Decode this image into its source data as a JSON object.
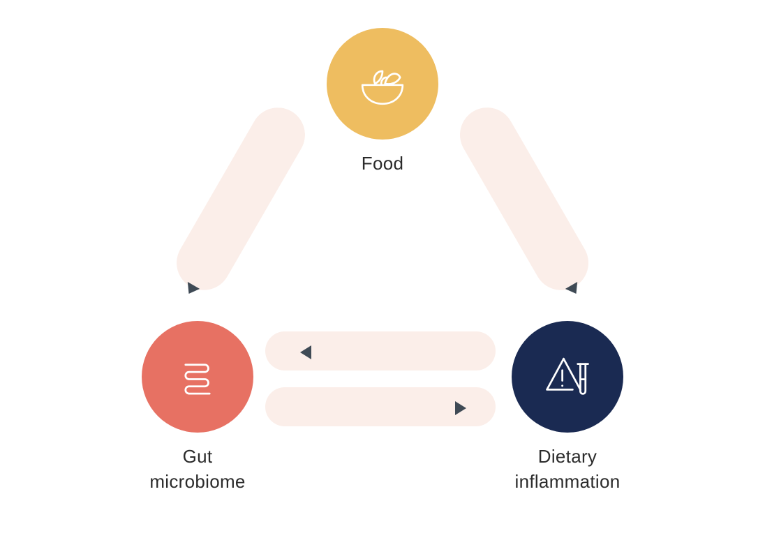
{
  "chart_data": {
    "type": "diagram",
    "nodes": [
      {
        "id": "food",
        "label": "Food",
        "icon": "bowl-icon",
        "color": "#eebd60"
      },
      {
        "id": "gut",
        "label": "Gut\nmicrobiome",
        "icon": "intestine-icon",
        "color": "#e77163"
      },
      {
        "id": "inflam",
        "label": "Dietary\ninflammation",
        "icon": "warning-tube-icon",
        "color": "#1a2a52"
      }
    ],
    "edges": [
      {
        "from": "food",
        "to": "gut",
        "style": "curved-band"
      },
      {
        "from": "food",
        "to": "inflam",
        "style": "curved-band"
      },
      {
        "from": "inflam",
        "to": "gut",
        "style": "straight-band"
      },
      {
        "from": "gut",
        "to": "inflam",
        "style": "straight-band"
      }
    ]
  },
  "labels": {
    "food": "Food",
    "gut_line1": "Gut",
    "gut_line2": "microbiome",
    "inflam_line1": "Dietary",
    "inflam_line2": "inflammation"
  },
  "colors": {
    "band": "#fbeee9",
    "arrowhead": "#3f4a55",
    "text": "#2b2b2b"
  }
}
